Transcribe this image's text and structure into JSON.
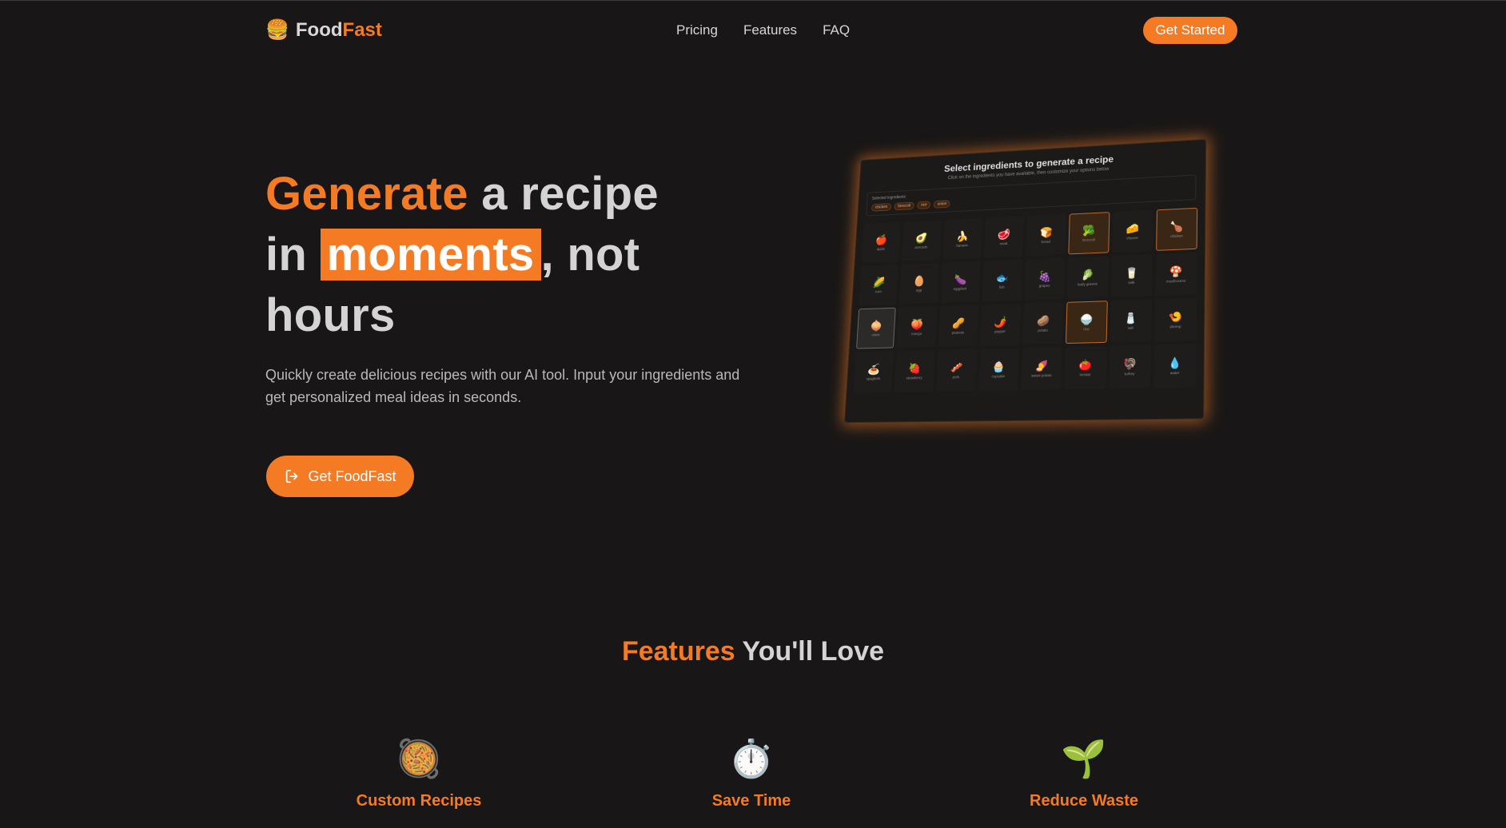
{
  "nav": {
    "logo_emoji": "🍔",
    "logo_part1": "Food",
    "logo_part2": "Fast",
    "links": [
      "Pricing",
      "Features",
      "FAQ"
    ],
    "cta": "Get Started"
  },
  "hero": {
    "title_accent": "Generate",
    "title_rest1": " a recipe",
    "title_in": "in ",
    "title_highlight": "moments",
    "title_rest2": ", not",
    "title_end": "hours",
    "subtitle": "Quickly create delicious recipes with our AI tool. Input your ingredients and get personalized meal ideas in seconds.",
    "cta": "Get FoodFast"
  },
  "mockup": {
    "title": "Select ingredients to generate a recipe",
    "subtitle": "Click on the ingredients you have available, then customize your options below",
    "selected_label": "Selected Ingredients:",
    "chips": [
      "chicken",
      "broccoli",
      "rice",
      "onion"
    ],
    "ingredients": [
      {
        "icon": "🍎",
        "name": "apple",
        "state": "off"
      },
      {
        "icon": "🥑",
        "name": "avocado",
        "state": "off"
      },
      {
        "icon": "🍌",
        "name": "banana",
        "state": "off"
      },
      {
        "icon": "🥩",
        "name": "meat",
        "state": "off"
      },
      {
        "icon": "🍞",
        "name": "bread",
        "state": "off"
      },
      {
        "icon": "🥦",
        "name": "broccoli",
        "state": "on"
      },
      {
        "icon": "🧀",
        "name": "cheese",
        "state": "off"
      },
      {
        "icon": "🍗",
        "name": "chicken",
        "state": "on"
      },
      {
        "icon": "🌽",
        "name": "corn",
        "state": "off"
      },
      {
        "icon": "🥚",
        "name": "egg",
        "state": "off"
      },
      {
        "icon": "🍆",
        "name": "eggplant",
        "state": "off"
      },
      {
        "icon": "🐟",
        "name": "fish",
        "state": "off"
      },
      {
        "icon": "🍇",
        "name": "grapes",
        "state": "off"
      },
      {
        "icon": "🥬",
        "name": "leafy greens",
        "state": "off"
      },
      {
        "icon": "🥛",
        "name": "milk",
        "state": "off"
      },
      {
        "icon": "🍄",
        "name": "mushrooms",
        "state": "off"
      },
      {
        "icon": "🧅",
        "name": "onion",
        "state": "on2"
      },
      {
        "icon": "🍑",
        "name": "mango",
        "state": "off"
      },
      {
        "icon": "🥜",
        "name": "peanuts",
        "state": "off"
      },
      {
        "icon": "🌶️",
        "name": "pepper",
        "state": "off"
      },
      {
        "icon": "🥔",
        "name": "potato",
        "state": "off"
      },
      {
        "icon": "🍚",
        "name": "rice",
        "state": "on"
      },
      {
        "icon": "🧂",
        "name": "salt",
        "state": "off"
      },
      {
        "icon": "🍤",
        "name": "shrimp",
        "state": "off"
      },
      {
        "icon": "🍝",
        "name": "spaghetti",
        "state": "off"
      },
      {
        "icon": "🍓",
        "name": "strawberry",
        "state": "off"
      },
      {
        "icon": "🥓",
        "name": "pork",
        "state": "off"
      },
      {
        "icon": "🧁",
        "name": "cupcake",
        "state": "off"
      },
      {
        "icon": "🍠",
        "name": "sweet potato",
        "state": "off"
      },
      {
        "icon": "🍅",
        "name": "tomato",
        "state": "off"
      },
      {
        "icon": "🦃",
        "name": "turkey",
        "state": "off"
      },
      {
        "icon": "💧",
        "name": "water",
        "state": "off"
      }
    ]
  },
  "features": {
    "title_accent": "Features",
    "title_rest": " You'll Love",
    "items": [
      {
        "icon": "🥘",
        "name": "Custom Recipes"
      },
      {
        "icon": "⏱️",
        "name": "Save Time"
      },
      {
        "icon": "🌱",
        "name": "Reduce Waste"
      }
    ]
  },
  "colors": {
    "accent": "#f47a24",
    "background": "#181616"
  }
}
